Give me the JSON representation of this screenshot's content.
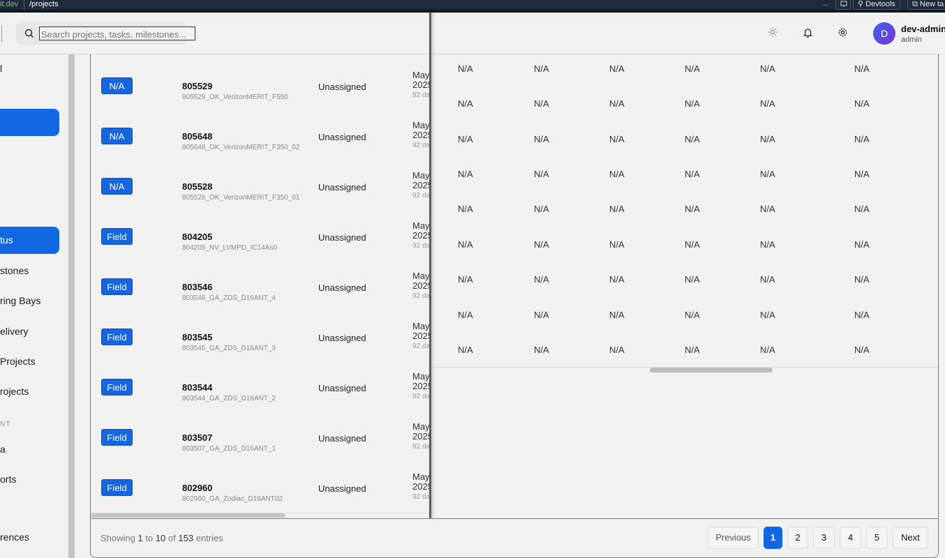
{
  "browser": {
    "url_host": "it.dev",
    "url_path": "/projects",
    "arrow": "→",
    "devtools_label": "Devtools",
    "newtab_label": "New ta"
  },
  "header": {
    "search_placeholder": "Search projects, tasks, milestones...",
    "user_initial": "D",
    "user_name": "dev-admin",
    "user_role": "admin",
    "icons": [
      "search-icon",
      "sun-icon",
      "bell-icon",
      "gear-icon"
    ]
  },
  "sidebar": {
    "items": [
      {
        "label": "l"
      },
      {
        "label": ""
      },
      {
        "label": "tus"
      },
      {
        "label": "stones"
      },
      {
        "label": "ring Bays"
      },
      {
        "label": "elivery"
      },
      {
        "label": "Projects"
      },
      {
        "label": "rojects"
      },
      {
        "label": "a"
      },
      {
        "label": "orts"
      },
      {
        "label": "rences"
      }
    ],
    "section_label": "NT"
  },
  "table": {
    "rows": [
      {
        "badge": "N/A",
        "id": "805529",
        "name": "805529_OK_VerizonMERIT_F550",
        "assigned": "Unassigned",
        "date1": "May",
        "date2": "2025",
        "age": "92 da"
      },
      {
        "badge": "N/A",
        "id": "805648",
        "name": "805648_OK_VerizonMERIT_F350_02",
        "assigned": "Unassigned",
        "date1": "May",
        "date2": "2025",
        "age": "92 da"
      },
      {
        "badge": "N/A",
        "id": "805528",
        "name": "805528_OK_VerizonMERIT_F350_01",
        "assigned": "Unassigned",
        "date1": "May",
        "date2": "2025",
        "age": "92 da"
      },
      {
        "badge": "Field",
        "id": "804205",
        "name": "804205_NV_LVMPD_IC14As0",
        "assigned": "Unassigned",
        "date1": "May",
        "date2": "2025",
        "age": "92 da"
      },
      {
        "badge": "Field",
        "id": "803546",
        "name": "803546_GA_ZDS_D16ANT_4",
        "assigned": "Unassigned",
        "date1": "May",
        "date2": "2025",
        "age": "92 da"
      },
      {
        "badge": "Field",
        "id": "803545",
        "name": "803545_GA_ZDS_D16ANT_3",
        "assigned": "Unassigned",
        "date1": "May",
        "date2": "2025",
        "age": "92 da"
      },
      {
        "badge": "Field",
        "id": "803544",
        "name": "803544_GA_ZDS_D16ANT_2",
        "assigned": "Unassigned",
        "date1": "May",
        "date2": "2025",
        "age": "92 da"
      },
      {
        "badge": "Field",
        "id": "803507",
        "name": "803507_GA_ZDS_D16ANT_1",
        "assigned": "Unassigned",
        "date1": "May",
        "date2": "2025",
        "age": "92 da"
      },
      {
        "badge": "Field",
        "id": "802960",
        "name": "802960_GA_Zodiac_D16ANT02",
        "assigned": "Unassigned",
        "date1": "May",
        "date2": "2025",
        "age": "92 da"
      }
    ],
    "right_cell_value": "N/A",
    "right_rows": 9,
    "right_cols": 6
  },
  "footer": {
    "showing_prefix": "Showing",
    "from": "1",
    "to_word": "to",
    "to": "10",
    "of_word": "of",
    "total": "153",
    "suffix": "entries",
    "prev_label": "Previous",
    "next_label": "Next",
    "pages": [
      "1",
      "2",
      "3",
      "4",
      "5"
    ],
    "current_page": "1"
  },
  "colors": {
    "accent": "#1268e3",
    "badge": "#1866de"
  }
}
